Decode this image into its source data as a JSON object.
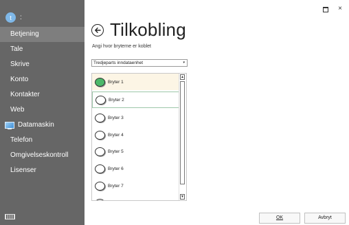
{
  "user": {
    "avatar_letter": "t",
    "separator": ":"
  },
  "sidebar": {
    "items": [
      {
        "label": "Betjening",
        "active": true
      },
      {
        "label": "Tale"
      },
      {
        "label": "Skrive"
      },
      {
        "label": "Konto"
      },
      {
        "label": "Kontakter"
      },
      {
        "label": "Web"
      },
      {
        "label": "Datamaskin",
        "icon": "monitor-icon"
      },
      {
        "label": "Telefon"
      },
      {
        "label": "Omgivelseskontroll"
      },
      {
        "label": "Lisenser"
      }
    ],
    "bottom_icon": "keyboard-icon"
  },
  "window": {
    "restore_icon": "restore-icon",
    "close_symbol": "×"
  },
  "page": {
    "title": "Tilkobling",
    "subtitle": "Angi hvor bryterne er koblet",
    "back_icon": "back-arrow-icon"
  },
  "source_dropdown": {
    "selected": "Tredjeparts inndataenhet",
    "arrow": "▾"
  },
  "switches": [
    {
      "label": "Bryter 1",
      "active": true,
      "selected": true
    },
    {
      "label": "Bryter 2",
      "focused": true
    },
    {
      "label": "Bryter 3"
    },
    {
      "label": "Bryter 4"
    },
    {
      "label": "Bryter 5"
    },
    {
      "label": "Bryter 6"
    },
    {
      "label": "Bryter 7"
    }
  ],
  "scrollbar": {
    "up": "▲",
    "down": "▼"
  },
  "buttons": {
    "ok": "OK",
    "cancel": "Avbryt"
  },
  "colors": {
    "sidebar_bg": "#666666",
    "sidebar_active": "#7e7e7e",
    "radio_on": "#4cb86a",
    "selected_row": "#fcf5e5"
  }
}
